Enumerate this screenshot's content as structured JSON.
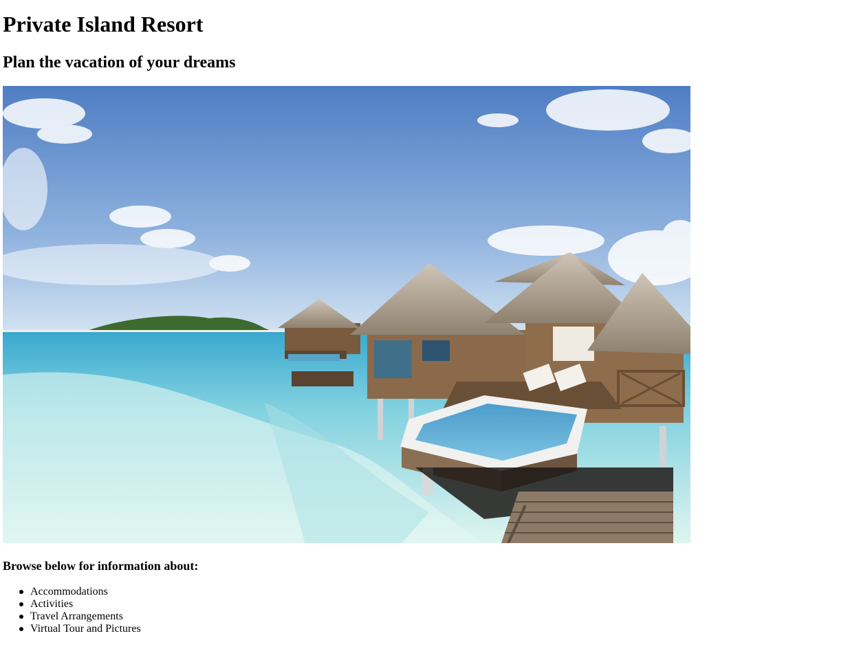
{
  "page": {
    "title": "Private Island Resort",
    "subtitle": "Plan the vacation of your dreams",
    "browse_heading": "Browse below for information about:",
    "topics": [
      {
        "label": "Accommodations"
      },
      {
        "label": "Activities"
      },
      {
        "label": "Travel Arrangements"
      },
      {
        "label": "Virtual Tour and Pictures"
      }
    ]
  },
  "hero_image": {
    "depicts": "overwater-bungalows-photo",
    "colors": {
      "sky_top": "#5b86c9",
      "sky_bottom": "#c9dcef",
      "water_deep": "#4fb6d4",
      "water_shallow": "#d6f1ee",
      "thatch": "#b8ab98",
      "wood": "#8a6a4a",
      "pool": "#5fa8cf"
    }
  }
}
